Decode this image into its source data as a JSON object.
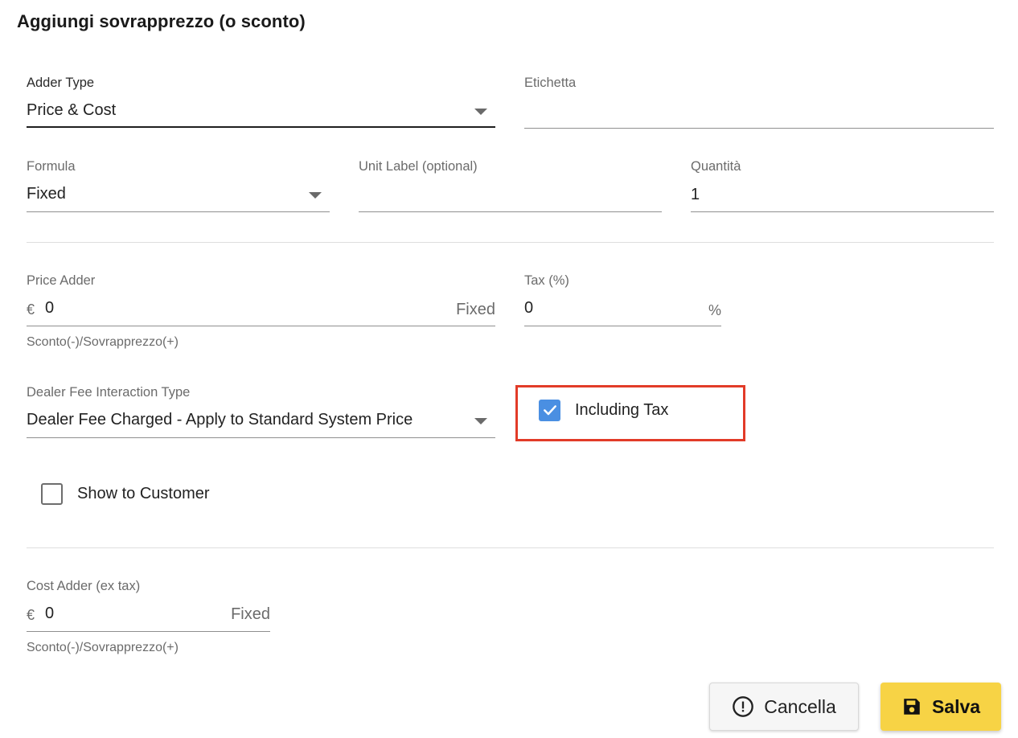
{
  "dialog": {
    "title": "Aggiungi sovrapprezzo (o sconto)"
  },
  "adder_type": {
    "label": "Adder Type",
    "value": "Price & Cost"
  },
  "etichetta": {
    "label": "Etichetta",
    "value": ""
  },
  "formula": {
    "label": "Formula",
    "value": "Fixed"
  },
  "unit_label": {
    "label": "Unit Label (optional)",
    "value": ""
  },
  "quantita": {
    "label": "Quantità",
    "value": "1"
  },
  "price_adder": {
    "label": "Price Adder",
    "prefix": "€",
    "value": "0",
    "suffix": "Fixed",
    "helper": "Sconto(-)/Sovrapprezzo(+)"
  },
  "tax": {
    "label": "Tax (%)",
    "value": "0",
    "suffix": "%"
  },
  "dealer_fee": {
    "label": "Dealer Fee Interaction Type",
    "value": "Dealer Fee Charged - Apply to Standard System Price"
  },
  "including_tax": {
    "label": "Including Tax",
    "checked": true
  },
  "show_to_customer": {
    "label": "Show to Customer",
    "checked": false
  },
  "cost_adder": {
    "label": "Cost Adder (ex tax)",
    "prefix": "€",
    "value": "0",
    "suffix": "Fixed",
    "helper": "Sconto(-)/Sovrapprezzo(+)"
  },
  "actions": {
    "cancel_label": "Cancella",
    "save_label": "Salva"
  },
  "colors": {
    "checkbox_checked": "#4a8fe2",
    "highlight_border": "#e23b28",
    "save_button": "#f7d345"
  },
  "icons": {
    "cancel": "alert-circle-icon",
    "save": "floppy-disk-icon",
    "dropdown": "caret-down-icon",
    "check": "check-icon"
  }
}
